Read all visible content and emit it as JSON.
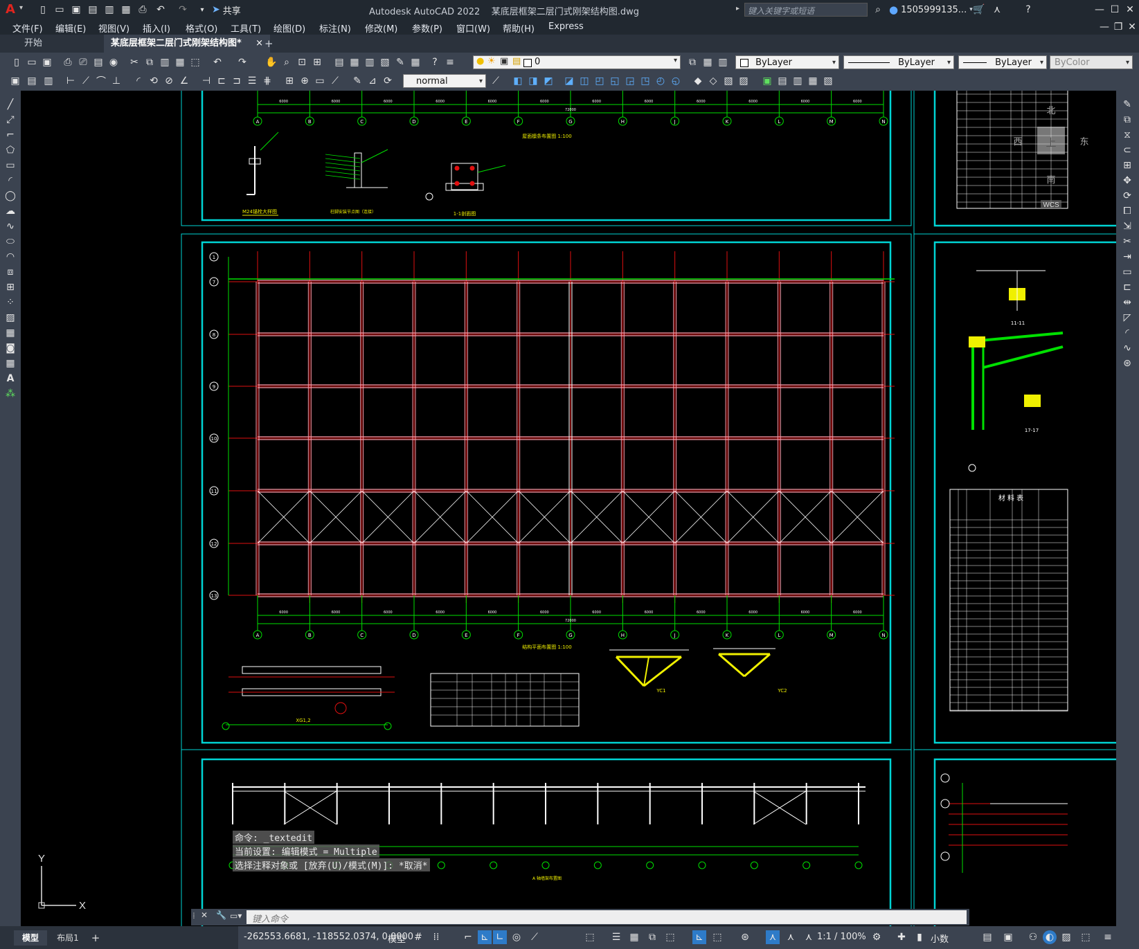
{
  "app": {
    "title": "Autodesk AutoCAD 2022    某底层框架二层门式刚架结构图.dwg",
    "share_label": "共享",
    "search_placeholder": "键入关键字或短语",
    "user": "1505999135...",
    "logo": "A"
  },
  "menu": [
    "文件(F)",
    "编辑(E)",
    "视图(V)",
    "插入(I)",
    "格式(O)",
    "工具(T)",
    "绘图(D)",
    "标注(N)",
    "修改(M)",
    "参数(P)",
    "窗口(W)",
    "帮助(H)",
    "Express"
  ],
  "tabs": {
    "start": "开始",
    "active": "某底层框架二层门式刚架结构图*",
    "close": "×",
    "add": "+"
  },
  "toolbar": {
    "layer_value": "0",
    "color_value": "ByLayer",
    "linetype_value": "ByLayer",
    "lineweight_value": "ByLayer",
    "plotstyle_value": "ByColor",
    "dimstyle_value": "normal"
  },
  "drawing": {
    "grid_letters": [
      "A",
      "B",
      "C",
      "D",
      "E",
      "F",
      "G",
      "H",
      "J",
      "K",
      "L",
      "M",
      "N"
    ],
    "grid_numbers": [
      "1",
      "7",
      "8",
      "9",
      "10",
      "11",
      "12",
      "13"
    ],
    "span_labels": [
      "6000",
      "6000",
      "6000",
      "6000",
      "6000",
      "6000",
      "6000",
      "6000",
      "6000",
      "6000",
      "6000",
      "6000"
    ],
    "total_length": "72000",
    "top_title": "屋面檩条布置图 1:100",
    "plan_title": "结构平面布置图 1:100",
    "detail_labels": [
      "M24锚栓大样图",
      "柱脚安装节点图（连接）",
      "1-1剖面图"
    ],
    "bottom_details": [
      "XG1,2",
      "YC1",
      "YC2"
    ],
    "sections": [
      "11-11",
      "17-17"
    ],
    "material_table_title": "材 料 表",
    "bottom_title": "A 轴墙架布置图"
  },
  "viewcube": {
    "top": "上",
    "north": "北",
    "south": "南",
    "east": "东",
    "west": "西",
    "wcs": "WCS"
  },
  "ucs": {
    "x": "X",
    "y": "Y"
  },
  "command": {
    "history": [
      "命令: _textedit",
      "当前设置: 编辑模式 = Multiple",
      "选择注释对象或 [放弃(U)/模式(M)]: *取消*"
    ],
    "placeholder": "键入命令"
  },
  "status": {
    "model_tab": "模型",
    "layout_tab": "布局1",
    "add": "+",
    "coords": "-262553.6681, -118552.0374, 0.0000",
    "model_label": "模型",
    "scale": "1:1 / 100%",
    "units": "小数"
  },
  "colors": {
    "background": "#000000",
    "frame": "#00d4d4",
    "grid_red": "#e01010",
    "beam_pink": "#ff9aa8",
    "dim_green": "#00e000",
    "yellow": "#f0f000",
    "white": "#ffffff"
  }
}
